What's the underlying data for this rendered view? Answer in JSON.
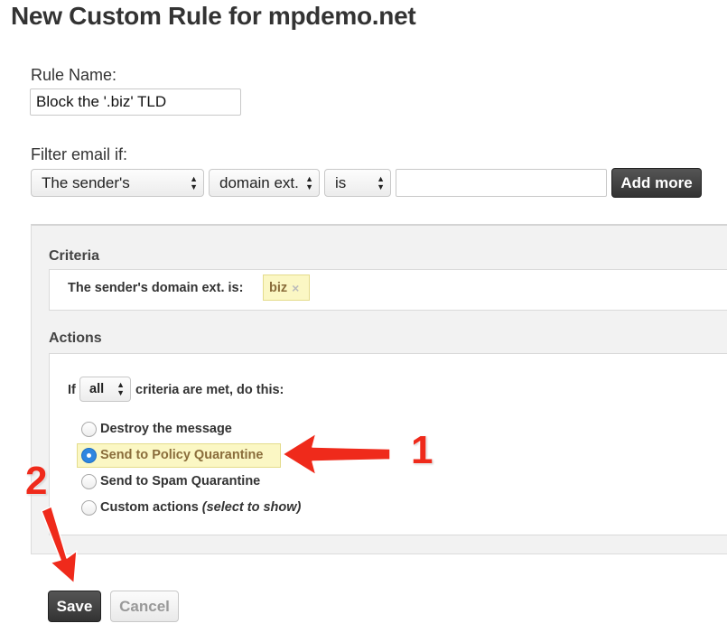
{
  "page": {
    "title": "New Custom Rule for mpdemo.net"
  },
  "rule_name": {
    "label": "Rule Name:",
    "value": "Block the '.biz' TLD"
  },
  "filter": {
    "label": "Filter email if:",
    "subject_select": "The sender's",
    "field_select": "domain ext.",
    "operator_select": "is",
    "value_input": "",
    "add_more_label": "Add more"
  },
  "criteria": {
    "title": "Criteria",
    "condition_label": "The sender's domain ext. is:",
    "tag_value": "biz",
    "tag_remove_icon": "×"
  },
  "actions": {
    "title": "Actions",
    "if_prefix": "If",
    "match_select": "all",
    "if_suffix": "criteria are met, do this:",
    "options": [
      {
        "label": "Destroy the message",
        "checked": false
      },
      {
        "label": "Send to Policy Quarantine",
        "checked": true
      },
      {
        "label": "Send to Spam Quarantine",
        "checked": false
      },
      {
        "label": "Custom actions",
        "hint": "(select to show)",
        "checked": false
      }
    ]
  },
  "buttons": {
    "save_label": "Save",
    "cancel_label": "Cancel"
  },
  "annotations": {
    "first": "1",
    "second": "2",
    "color": "#ef2a1b"
  }
}
